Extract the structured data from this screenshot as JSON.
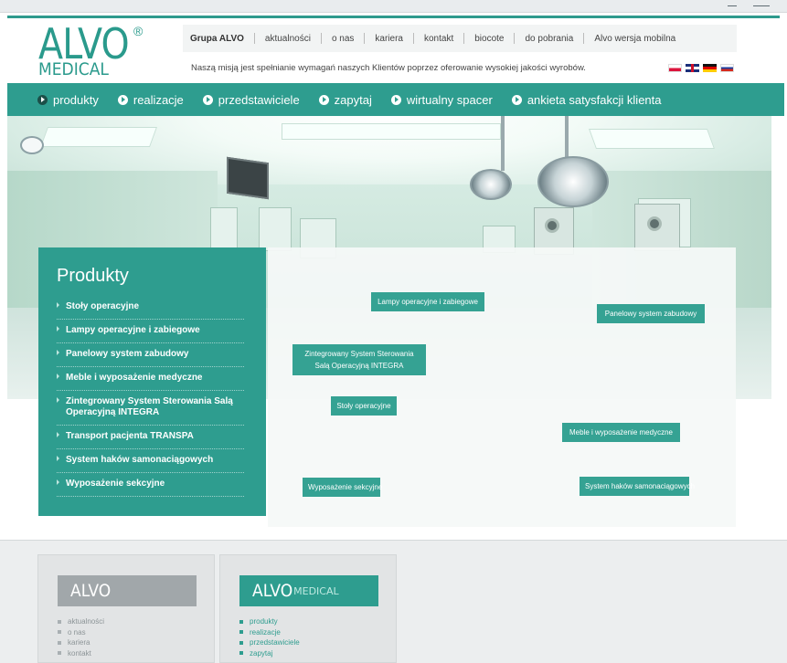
{
  "logo": {
    "alvo": "ALVO",
    "registered": "®",
    "medical": "MEDICAL"
  },
  "topnav": {
    "items": [
      "Grupa ALVO",
      "aktualności",
      "o nas",
      "kariera",
      "kontakt",
      "biocote",
      "do pobrania",
      "Alvo wersja mobilna"
    ]
  },
  "mission": "Naszą misją jest spełnianie wymagań naszych Klientów poprzez oferowanie wysokiej jakości wyrobów.",
  "languages": [
    "pl-flag-icon",
    "en-flag-icon",
    "de-flag-icon",
    "ru-flag-icon"
  ],
  "mainnav": {
    "items": [
      "produkty",
      "realizacje",
      "przedstawiciele",
      "zapytaj",
      "wirtualny spacer",
      "ankieta satysfakcji klienta"
    ],
    "active_index": 0
  },
  "produkty": {
    "title": "Produkty",
    "items": [
      "Stoły operacyjne",
      "Lampy operacyjne i zabiegowe",
      "Panelowy system zabudowy",
      "Meble i wyposażenie medyczne",
      "Zintegrowany System Sterowania Salą Operacyjną INTEGRA",
      "Transport pacjenta TRANSPA",
      "System haków samonaciągowych",
      "Wyposażenie sekcyjne"
    ]
  },
  "hotspots": {
    "lampy": "Lampy operacyjne i zabiegowe",
    "panelowy": "Panelowy system zabudowy",
    "integra": "Zintegrowany System Sterowania Salą Operacyjną INTEGRA",
    "stoly": "Stoły operacyjne",
    "meble": "Meble i wyposażenie medyczne",
    "sekcyjne": "Wyposażenie sekcyjne",
    "haki": "System haków samonaciągowych"
  },
  "footer": {
    "box1": {
      "title": "ALVO",
      "links": [
        "aktualności",
        "o nas",
        "kariera",
        "kontakt"
      ]
    },
    "box2": {
      "title_main": "ALVO",
      "title_sub": "MEDICAL",
      "links": [
        "produkty",
        "realizacje",
        "przedstawiciele",
        "zapytaj"
      ]
    }
  },
  "colors": {
    "accent": "#2e9d8f",
    "text": "#444444",
    "footer_bg": "#eceeef"
  }
}
